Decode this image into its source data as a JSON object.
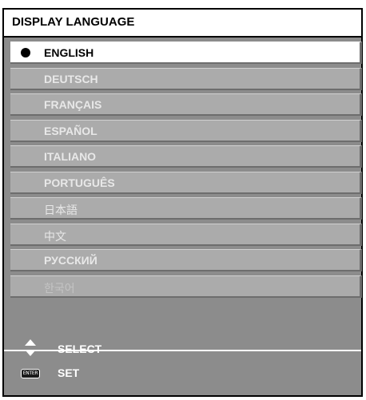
{
  "title": "DISPLAY LANGUAGE",
  "languages": [
    {
      "label": "ENGLISH"
    },
    {
      "label": "DEUTSCH"
    },
    {
      "label": "FRANÇAIS"
    },
    {
      "label": "ESPAÑOL"
    },
    {
      "label": "ITALIANO"
    },
    {
      "label": "PORTUGUÊS"
    },
    {
      "label": "日本語"
    },
    {
      "label": "中文"
    },
    {
      "label": "РУССКИЙ"
    },
    {
      "label": "한국어"
    }
  ],
  "selected_language": "ENGLISH",
  "disabled_language": "한국어",
  "footer": {
    "select_label": "SELECT",
    "set_label": "SET",
    "enter_key_label": "ENTER"
  },
  "icons": {
    "selected_marker": "filled-circle-icon",
    "select": "up-down-arrows-icon",
    "set": "enter-key-icon"
  },
  "colors": {
    "panel_background": "#8c8c8c",
    "item_background": "#ababab",
    "selected_item_background": "#ffffff",
    "item_text": "#e8e8e8",
    "selected_text": "#000000"
  }
}
